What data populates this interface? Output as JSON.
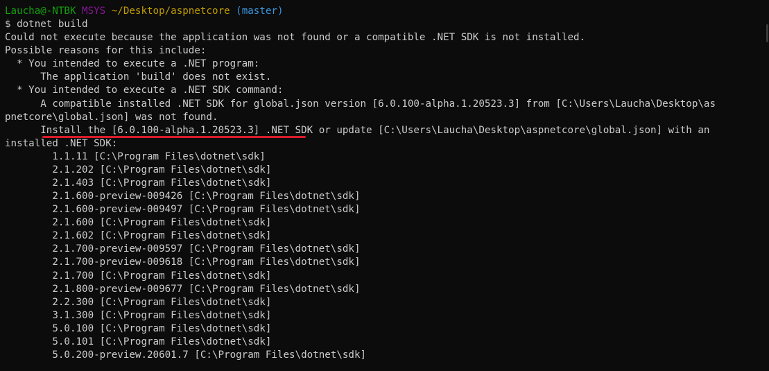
{
  "prompt": {
    "user_host": "Laucha@-NTBK",
    "system": "MSYS",
    "path": "~/Desktop/aspnetcore",
    "branch": "(master)"
  },
  "command": "$ dotnet build",
  "output": {
    "line1": "Could not execute because the application was not found or a compatible .NET SDK is not installed.",
    "line2": "Possible reasons for this include:",
    "line3": "  * You intended to execute a .NET program:",
    "line4": "      The application 'build' does not exist.",
    "line5": "  * You intended to execute a .NET SDK command:",
    "line6": "      A compatible installed .NET SDK for global.json version [6.0.100-alpha.1.20523.3] from [C:\\Users\\Laucha\\Desktop\\as",
    "line7": "pnetcore\\global.json] was not found.",
    "line8": "      Install the [6.0.100-alpha.1.20523.3] .NET SDK or update [C:\\Users\\Laucha\\Desktop\\aspnetcore\\global.json] with an",
    "line9": "installed .NET SDK:"
  },
  "sdks": [
    "        1.1.11 [C:\\Program Files\\dotnet\\sdk]",
    "        2.1.202 [C:\\Program Files\\dotnet\\sdk]",
    "        2.1.403 [C:\\Program Files\\dotnet\\sdk]",
    "        2.1.600-preview-009426 [C:\\Program Files\\dotnet\\sdk]",
    "        2.1.600-preview-009497 [C:\\Program Files\\dotnet\\sdk]",
    "        2.1.600 [C:\\Program Files\\dotnet\\sdk]",
    "        2.1.602 [C:\\Program Files\\dotnet\\sdk]",
    "        2.1.700-preview-009597 [C:\\Program Files\\dotnet\\sdk]",
    "        2.1.700-preview-009618 [C:\\Program Files\\dotnet\\sdk]",
    "        2.1.700 [C:\\Program Files\\dotnet\\sdk]",
    "        2.1.800-preview-009677 [C:\\Program Files\\dotnet\\sdk]",
    "        2.2.300 [C:\\Program Files\\dotnet\\sdk]",
    "        3.1.300 [C:\\Program Files\\dotnet\\sdk]",
    "        5.0.100 [C:\\Program Files\\dotnet\\sdk]",
    "        5.0.101 [C:\\Program Files\\dotnet\\sdk]",
    "        5.0.200-preview.20601.7 [C:\\Program Files\\dotnet\\sdk]"
  ],
  "colors": {
    "background": "#0c0c0c",
    "text": "#cccccc",
    "user_host": "#13a10e",
    "system": "#881798",
    "path": "#c19c00",
    "branch": "#3a96dd",
    "annotation_underline": "#d81b2a"
  }
}
